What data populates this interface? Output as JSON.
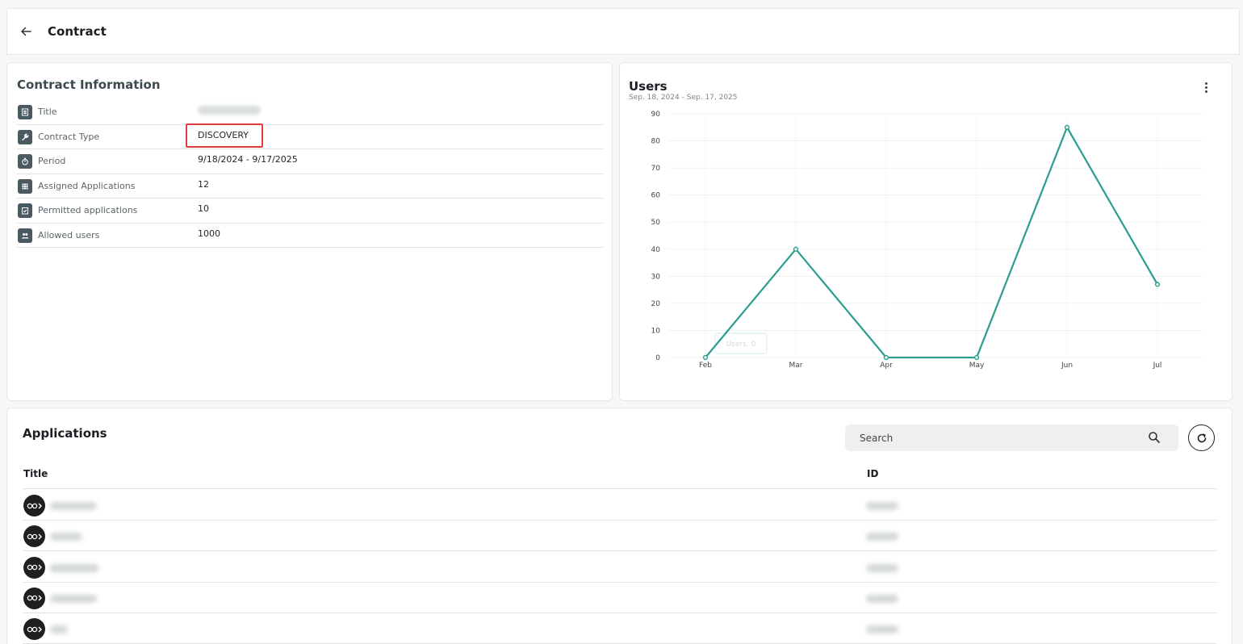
{
  "header": {
    "title": "Contract",
    "back_icon": "arrow-left-icon"
  },
  "contract_info": {
    "heading": "Contract Information",
    "rows": [
      {
        "label": "Title",
        "value": "",
        "icon": "document-icon"
      },
      {
        "label": "Contract Type",
        "value": "DISCOVERY",
        "icon": "wrench-icon"
      },
      {
        "label": "Period",
        "value": "9/18/2024 - 9/17/2025",
        "icon": "stopwatch-icon"
      },
      {
        "label": "Assigned Applications",
        "value": "12",
        "icon": "grid-icon"
      },
      {
        "label": "Permitted applications",
        "value": "10",
        "icon": "checklist-icon"
      },
      {
        "label": "Allowed users",
        "value": "1000",
        "icon": "users-icon"
      }
    ],
    "highlight_color": "#e03c3c"
  },
  "users_card": {
    "title": "Users",
    "date_range": "Sep. 18, 2024 - Sep. 17, 2025",
    "menu_icon": "kebab-menu-icon",
    "tooltip": "Users: 0"
  },
  "chart_data": {
    "type": "line",
    "title": "Users",
    "subtitle": "Sep. 18, 2024 - Sep. 17, 2025",
    "categories": [
      "Feb",
      "Mar",
      "Apr",
      "May",
      "Jun",
      "Jul"
    ],
    "values": [
      0,
      40,
      0,
      0,
      85,
      27
    ],
    "ylim": [
      0,
      90
    ],
    "yticks": [
      0,
      10,
      20,
      30,
      40,
      50,
      60,
      70,
      80,
      90
    ],
    "grid": true,
    "line_color": "#2a9d8f"
  },
  "applications": {
    "title": "Applications",
    "search_placeholder": "Search",
    "columns": {
      "title": "Title",
      "id": "ID"
    },
    "row_count": 5,
    "logo_icon": "app-logo-icon"
  }
}
